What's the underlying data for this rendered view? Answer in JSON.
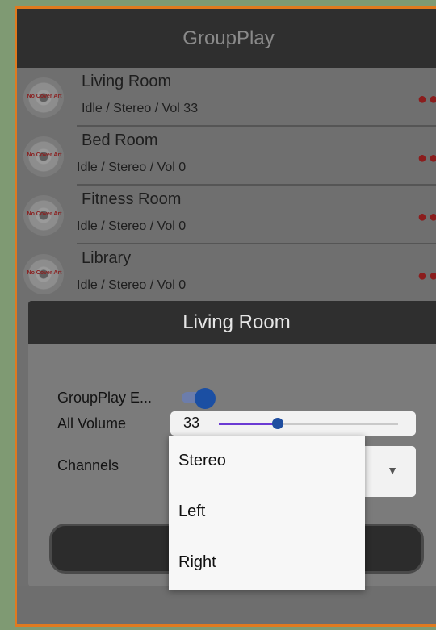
{
  "app": {
    "title": "GroupPlay"
  },
  "rooms": [
    {
      "name": "Living Room",
      "status": "Idle / Stereo / Vol 33",
      "cover_text": "No Cover Art"
    },
    {
      "name": "Bed Room",
      "status": "Idle / Stereo / Vol 0",
      "cover_text": "No Cover Art"
    },
    {
      "name": "Fitness Room",
      "status": "Idle / Stereo / Vol 0",
      "cover_text": "No Cover Art"
    },
    {
      "name": "Library",
      "status": "Idle / Stereo / Vol 0",
      "cover_text": "No Cover Art"
    }
  ],
  "row_menu_glyph": "●●",
  "dialog": {
    "title": "Living Room",
    "groupplay_label": "GroupPlay E...",
    "groupplay_enabled": true,
    "volume_label": "All Volume",
    "volume_value": "33",
    "volume_fraction": 0.33,
    "channels_label": "Channels",
    "channels_selected": "Stereo",
    "caret": "▼"
  },
  "dropdown": {
    "options": [
      "Stereo",
      "Left",
      "Right"
    ]
  },
  "colors": {
    "frame_border": "#e07a1f",
    "accent": "#1b4fa3",
    "slider_fill": "#6b3ad3",
    "menu_dots": "#8b1d1d"
  }
}
